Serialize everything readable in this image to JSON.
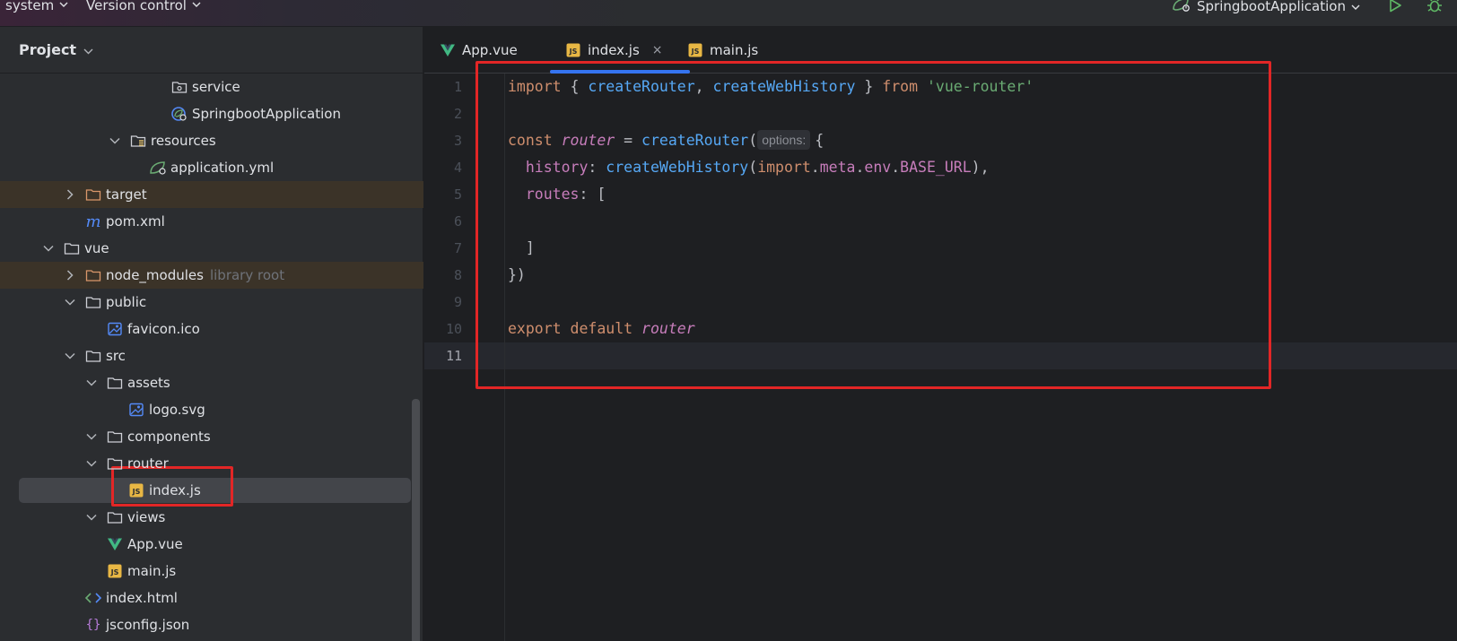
{
  "menu": {
    "system_label": "system",
    "vcs_label": "Version control"
  },
  "run_config": {
    "label": "SpringbootApplication"
  },
  "project_panel": {
    "title": "Project",
    "tree": [
      {
        "label": "service",
        "icon": "package-folder-icon"
      },
      {
        "label": "SpringbootApplication",
        "icon": "spring-boot-app-icon"
      },
      {
        "label": "resources",
        "icon": "resources-folder-icon"
      },
      {
        "label": "application.yml",
        "icon": "spring-config-icon"
      },
      {
        "label": "target",
        "icon": "folder-icon"
      },
      {
        "label": "pom.xml",
        "icon": "maven-icon"
      },
      {
        "label": "vue",
        "icon": "folder-icon"
      },
      {
        "label": "node_modules",
        "hint": "library root",
        "icon": "folder-icon"
      },
      {
        "label": "public",
        "icon": "folder-icon"
      },
      {
        "label": "favicon.ico",
        "icon": "image-file-icon"
      },
      {
        "label": "src",
        "icon": "folder-icon"
      },
      {
        "label": "assets",
        "icon": "folder-icon"
      },
      {
        "label": "logo.svg",
        "icon": "image-file-icon"
      },
      {
        "label": "components",
        "icon": "folder-icon"
      },
      {
        "label": "router",
        "icon": "folder-icon"
      },
      {
        "label": "index.js",
        "icon": "js-file-icon"
      },
      {
        "label": "views",
        "icon": "folder-icon"
      },
      {
        "label": "App.vue",
        "icon": "vue-file-icon"
      },
      {
        "label": "main.js",
        "icon": "js-file-icon"
      },
      {
        "label": "index.html",
        "icon": "html-file-icon"
      },
      {
        "label": "jsconfig.json",
        "icon": "json-file-icon"
      }
    ]
  },
  "editor": {
    "tabs": [
      {
        "label": "App.vue",
        "icon": "vue-file-icon"
      },
      {
        "label": "index.js",
        "icon": "js-file-icon",
        "close": "×"
      },
      {
        "label": "main.js",
        "icon": "js-file-icon"
      }
    ],
    "line_numbers": [
      "1",
      "2",
      "3",
      "4",
      "5",
      "6",
      "7",
      "8",
      "9",
      "10",
      "11"
    ],
    "code": {
      "l1": {
        "kw": "import",
        "t1": " { ",
        "fn1": "createRouter",
        "t2": ", ",
        "fn2": "createWebHistory",
        "t3": " } ",
        "kw2": "from",
        "t4": " ",
        "str": "'vue-router'"
      },
      "l3": {
        "kw": "const",
        "t1": " ",
        "var": "router",
        "t2": " = ",
        "fn": "createRouter",
        "t3": "(",
        "inlay": "options:",
        "t4": "{"
      },
      "l4": {
        "indent": "  ",
        "prop": "history",
        "t1": ": ",
        "fn": "createWebHistory",
        "t2": "(",
        "kw": "import",
        "t3": ".",
        "m1": "meta",
        "t4": ".",
        "m2": "env",
        "t5": ".",
        "m3": "BASE_URL",
        "t6": "),"
      },
      "l5": {
        "indent": "  ",
        "prop": "routes",
        "t1": ": ["
      },
      "l7": {
        "text": "  ]"
      },
      "l8": {
        "text": "})"
      },
      "l10": {
        "kw1": "export",
        "t1": " ",
        "kw2": "default",
        "t2": " ",
        "var": "router"
      }
    }
  },
  "colors": {
    "accent": "#3574f0",
    "highlight_box": "#e22626",
    "keyword": "#cf8e6d",
    "function": "#56a8f5",
    "string": "#6aab73",
    "variable": "#c77dbb"
  }
}
